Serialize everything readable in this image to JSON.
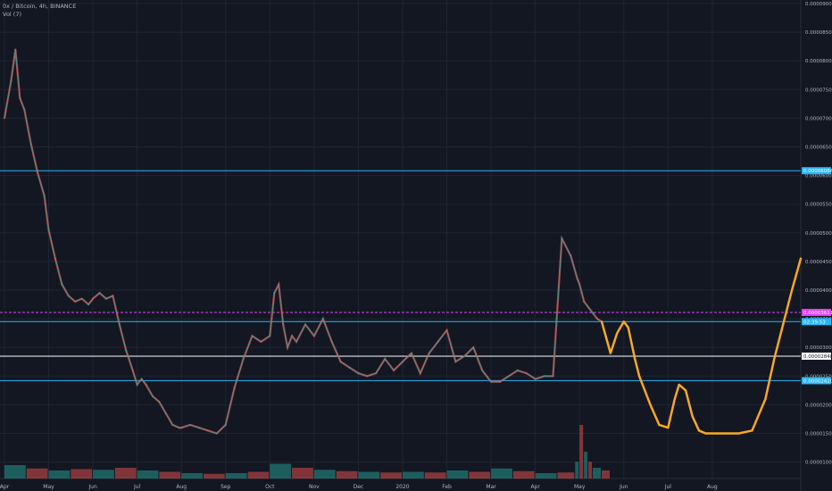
{
  "header": {
    "symbol_line": "0x / Bitcoin, 4h, BINANCE",
    "indicator_line": "Vol (7)"
  },
  "colors": {
    "background": "#131722",
    "grid": "#1f2433",
    "axis_text": "#b2b5be",
    "candle_up": "#26a69a",
    "candle_down": "#ef5350",
    "cyan_line": "#29b6f6",
    "white_line": "#ffffff",
    "magenta_line": "#e040fb",
    "projection": "#f9a825"
  },
  "chart_data": {
    "type": "line",
    "title": "",
    "y_axis": {
      "min": 9e-06,
      "max": 9e-05,
      "tick_labels": [
        "0.00009000",
        "0.00008500",
        "0.00008000",
        "0.00007500",
        "0.00007000",
        "0.00006500",
        "0.00006000",
        "0.00005500",
        "0.00005000",
        "0.00004500",
        "0.00004000",
        "0.00003500",
        "0.00003000",
        "0.00002500",
        "0.00002000",
        "0.00001500",
        "0.00001000"
      ],
      "tick_values": [
        9e-05,
        8.5e-05,
        8e-05,
        7.5e-05,
        7e-05,
        6.5e-05,
        6e-05,
        5.5e-05,
        5e-05,
        4.5e-05,
        4e-05,
        3.5e-05,
        3e-05,
        2.5e-05,
        2e-05,
        1.5e-05,
        1e-05
      ]
    },
    "x_axis": {
      "tick_labels": [
        "Apr",
        "May",
        "Jun",
        "Jul",
        "Aug",
        "Sep",
        "Oct",
        "Nov",
        "Dec",
        "2020",
        "Feb",
        "Mar",
        "Apr",
        "May",
        "Jun",
        "Jul",
        "Aug"
      ],
      "tick_index": [
        0,
        1,
        2,
        3,
        4,
        5,
        6,
        7,
        8,
        9,
        10,
        11,
        12,
        13,
        14,
        15,
        16
      ],
      "range": [
        -0.1,
        18.0
      ]
    },
    "price_series": {
      "name": "",
      "x": [
        0,
        0.15,
        0.25,
        0.35,
        0.45,
        0.6,
        0.75,
        0.9,
        1.0,
        1.15,
        1.3,
        1.45,
        1.6,
        1.75,
        1.9,
        2.0,
        2.15,
        2.3,
        2.45,
        2.6,
        2.75,
        2.9,
        3.0,
        3.1,
        3.2,
        3.35,
        3.5,
        3.65,
        3.8,
        3.95,
        4.0,
        4.2,
        4.4,
        4.6,
        4.8,
        5.0,
        5.2,
        5.4,
        5.6,
        5.8,
        6.0,
        6.1,
        6.2,
        6.3,
        6.4,
        6.5,
        6.6,
        6.8,
        7.0,
        7.2,
        7.4,
        7.6,
        7.8,
        8.0,
        8.2,
        8.4,
        8.6,
        8.8,
        9.0,
        9.2,
        9.4,
        9.6,
        9.8,
        10.0,
        10.2,
        10.4,
        10.6,
        10.8,
        11.0,
        11.2,
        11.4,
        11.6,
        11.8,
        12.0,
        12.2,
        12.4,
        12.6,
        12.8,
        12.95,
        13.0,
        13.05,
        13.1,
        13.2,
        13.3,
        13.4,
        13.5
      ],
      "values": [
        7e-05,
        7.65e-05,
        8.2e-05,
        7.35e-05,
        7.15e-05,
        6.55e-05,
        6.05e-05,
        5.65e-05,
        5.05e-05,
        4.55e-05,
        4.1e-05,
        3.9e-05,
        3.8e-05,
        3.85e-05,
        3.75e-05,
        3.85e-05,
        3.95e-05,
        3.85e-05,
        3.9e-05,
        3.4e-05,
        2.95e-05,
        2.6e-05,
        2.35e-05,
        2.45e-05,
        2.35e-05,
        2.15e-05,
        2.05e-05,
        1.85e-05,
        1.65e-05,
        1.6e-05,
        1.6e-05,
        1.65e-05,
        1.6e-05,
        1.55e-05,
        1.5e-05,
        1.65e-05,
        2.3e-05,
        2.8e-05,
        3.2e-05,
        3.1e-05,
        3.2e-05,
        3.95e-05,
        4.1e-05,
        3.4e-05,
        3e-05,
        3.2e-05,
        3.1e-05,
        3.4e-05,
        3.2e-05,
        3.5e-05,
        3.1e-05,
        2.75e-05,
        2.65e-05,
        2.55e-05,
        2.5e-05,
        2.55e-05,
        2.8e-05,
        2.6e-05,
        2.75e-05,
        2.9e-05,
        2.55e-05,
        2.9e-05,
        3.1e-05,
        3.3e-05,
        2.75e-05,
        2.85e-05,
        3e-05,
        2.6e-05,
        2.4e-05,
        2.4e-05,
        2.5e-05,
        2.6e-05,
        2.55e-05,
        2.45e-05,
        2.5e-05,
        2.5e-05,
        4.9e-05,
        4.6e-05,
        4.2e-05,
        4.1e-05,
        3.95e-05,
        3.8e-05,
        3.7e-05,
        3.6e-05,
        3.5e-05,
        3.45e-05
      ]
    },
    "volume_series": {
      "x": [
        0,
        0.5,
        1.0,
        1.5,
        2.0,
        2.5,
        3.0,
        3.5,
        4.0,
        4.5,
        5.0,
        5.5,
        6.0,
        6.5,
        7.0,
        7.5,
        8.0,
        8.5,
        9.0,
        9.5,
        10.0,
        10.5,
        11.0,
        11.5,
        12.0,
        12.5,
        12.9,
        13.0,
        13.1,
        13.2,
        13.3,
        13.5
      ],
      "values": [
        2.0,
        1.5,
        1.2,
        1.4,
        1.3,
        1.6,
        1.2,
        1.0,
        0.8,
        0.7,
        0.8,
        1.0,
        2.2,
        1.6,
        1.3,
        1.1,
        1.0,
        0.9,
        1.0,
        0.9,
        1.2,
        1.0,
        1.5,
        1.1,
        0.8,
        0.9,
        2.5,
        8.0,
        4.0,
        2.5,
        1.6,
        1.2
      ]
    },
    "projection_series": {
      "name": "",
      "x": [
        13.5,
        13.7,
        13.85,
        14.0,
        14.1,
        14.25,
        14.35,
        14.6,
        14.8,
        15.0,
        15.15,
        15.25,
        15.4,
        15.55,
        15.7,
        15.85,
        16.0,
        16.3,
        16.6,
        16.9,
        17.2,
        17.4,
        17.6,
        17.8,
        18.0
      ],
      "values": [
        3.45e-05,
        2.9e-05,
        3.25e-05,
        3.45e-05,
        3.35e-05,
        2.8e-05,
        2.5e-05,
        2e-05,
        1.65e-05,
        1.6e-05,
        2.1e-05,
        2.35e-05,
        2.25e-05,
        1.8e-05,
        1.55e-05,
        1.5e-05,
        1.5e-05,
        1.5e-05,
        1.5e-05,
        1.55e-05,
        2.1e-05,
        2.8e-05,
        3.4e-05,
        4e-05,
        4.55e-05
      ]
    },
    "horizontal_lines": [
      {
        "value": 6.084e-05,
        "label": "0.00006084",
        "style": "cyan"
      },
      {
        "value": 3.611e-05,
        "label": "0.00003611",
        "style": "magenta-dashed"
      },
      {
        "value": 3.45e-05,
        "label": "02:39:53",
        "style": "cyan"
      },
      {
        "value": 2.848e-05,
        "label": "0.00002848",
        "style": "white"
      },
      {
        "value": 2.42e-05,
        "label": "0.00002420",
        "style": "cyan"
      }
    ],
    "grid": true,
    "legend": ""
  }
}
